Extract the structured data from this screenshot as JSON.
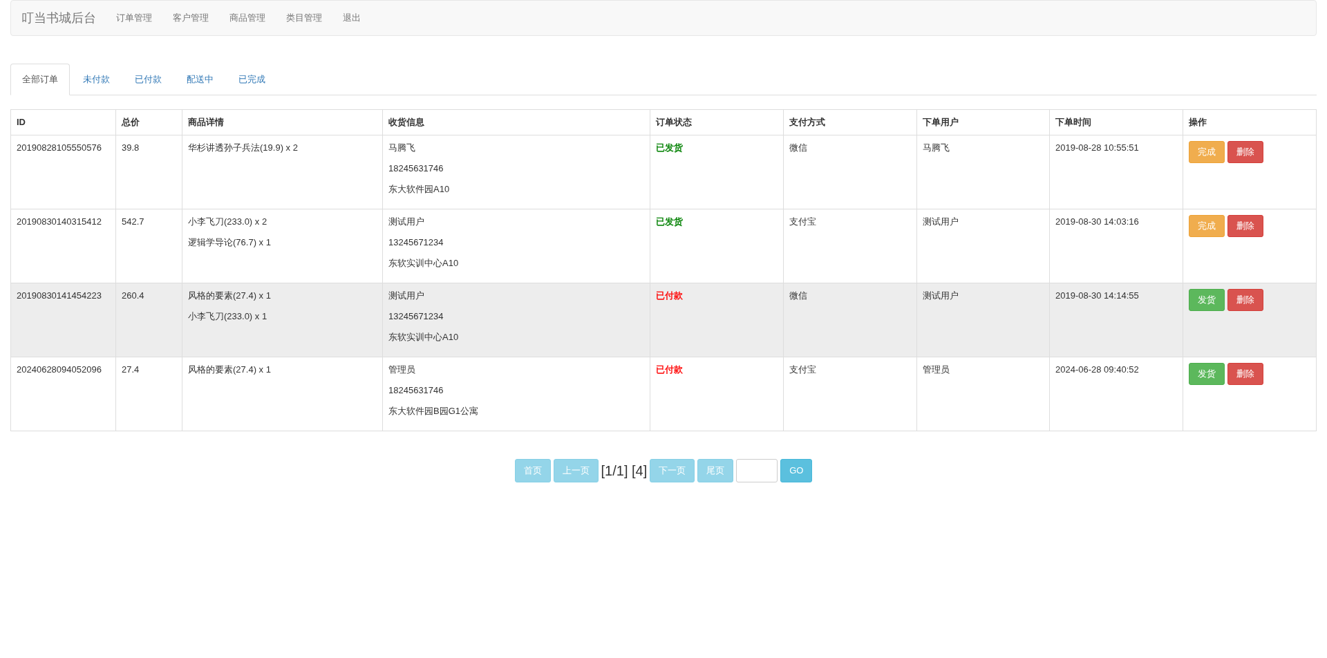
{
  "navbar": {
    "brand": "叮当书城后台",
    "links": [
      "订单管理",
      "客户管理",
      "商品管理",
      "类目管理",
      "退出"
    ]
  },
  "tabs": [
    {
      "label": "全部订单",
      "selected": true
    },
    {
      "label": "未付款",
      "selected": false
    },
    {
      "label": "已付款",
      "selected": false
    },
    {
      "label": "配送中",
      "selected": false
    },
    {
      "label": "已完成",
      "selected": false
    }
  ],
  "table": {
    "columns": [
      "ID",
      "总价",
      "商品详情",
      "收货信息",
      "订单状态",
      "支付方式",
      "下单用户",
      "下单时间",
      "操作"
    ],
    "rows": [
      {
        "id": "20190828105550576",
        "total": "39.8",
        "items": [
          "华杉讲透孙子兵法(19.9) x 2"
        ],
        "shipping": [
          "马腾飞",
          "18245631746",
          "东大软件园A10"
        ],
        "status": {
          "text": "已发货",
          "color": "#008000"
        },
        "payment": "微信",
        "user": "马腾飞",
        "time": "2019-08-28 10:55:51",
        "highlighted": false,
        "actions": [
          {
            "label": "完成",
            "kind": "warning"
          },
          {
            "label": "删除",
            "kind": "danger"
          }
        ]
      },
      {
        "id": "20190830140315412",
        "total": "542.7",
        "items": [
          "小李飞刀(233.0) x 2",
          "逻辑学导论(76.7) x 1"
        ],
        "shipping": [
          "测试用户",
          "13245671234",
          "东软实训中心A10"
        ],
        "status": {
          "text": "已发货",
          "color": "#008000"
        },
        "payment": "支付宝",
        "user": "测试用户",
        "time": "2019-08-30 14:03:16",
        "highlighted": false,
        "actions": [
          {
            "label": "完成",
            "kind": "warning"
          },
          {
            "label": "删除",
            "kind": "danger"
          }
        ]
      },
      {
        "id": "20190830141454223",
        "total": "260.4",
        "items": [
          "风格的要素(27.4) x 1",
          "小李飞刀(233.0) x 1"
        ],
        "shipping": [
          "测试用户",
          "13245671234",
          "东软实训中心A10"
        ],
        "status": {
          "text": "已付款",
          "color": "#ff0000"
        },
        "payment": "微信",
        "user": "测试用户",
        "time": "2019-08-30 14:14:55",
        "highlighted": true,
        "actions": [
          {
            "label": "发货",
            "kind": "success"
          },
          {
            "label": "删除",
            "kind": "danger"
          }
        ]
      },
      {
        "id": "20240628094052096",
        "total": "27.4",
        "items": [
          "风格的要素(27.4) x 1"
        ],
        "shipping": [
          "管理员",
          "18245631746",
          "东大软件园B园G1公寓"
        ],
        "status": {
          "text": "已付款",
          "color": "#ff0000"
        },
        "payment": "支付宝",
        "user": "管理员",
        "time": "2024-06-28 09:40:52",
        "highlighted": false,
        "actions": [
          {
            "label": "发货",
            "kind": "success"
          },
          {
            "label": "删除",
            "kind": "danger"
          }
        ]
      }
    ]
  },
  "pagination": {
    "buttons_before": [
      {
        "label": "首页",
        "disabled": true
      },
      {
        "label": "上一页",
        "disabled": true
      }
    ],
    "info": "[1/1] [4]",
    "buttons_after": [
      {
        "label": "下一页",
        "disabled": true
      },
      {
        "label": "尾页",
        "disabled": true
      }
    ],
    "go": {
      "label": "GO",
      "disabled": false
    }
  }
}
